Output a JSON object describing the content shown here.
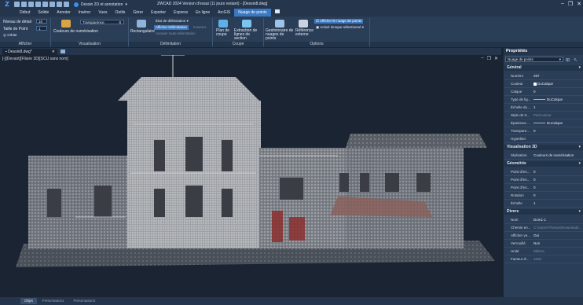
{
  "titlebar": {
    "workspace": "Dessin 2D et annotation",
    "title": "ZWCAD 2024 Version d'essai (11 jours restant) - [Dessin8.dwg]"
  },
  "tabs": [
    "Début",
    "Solide",
    "Annoter",
    "Insérer",
    "Vues",
    "Outils",
    "Gérer",
    "Exporter",
    "Express",
    "En ligne",
    "ArcGIS",
    "Nuage de points"
  ],
  "active_tab": "Nuage de points",
  "ribbon": {
    "afficher": {
      "title": "Afficher",
      "detail_label": "Niveau de détail",
      "detail_value": "10",
      "point_size_label": "Taille de Point",
      "point_size_value": "1",
      "orbit_label": "Orbite"
    },
    "visualisation": {
      "title": "Visualisation",
      "colors_label": "Couleurs de numérisation",
      "transparency_label": "Transparence",
      "transparency_value": "8"
    },
    "delimitation": {
      "title": "Délimitation",
      "rect_label": "Rectangulaire",
      "state_label": "État de délimitation",
      "show_clip_label": "Afficher Délimitation",
      "inverse_label": "Inverser",
      "remove_label": "Annuler toute délimitation"
    },
    "coupe": {
      "title": "Coupe",
      "plan_label": "Plan de coupe",
      "extract_label": "Extraction de lignes de section"
    },
    "options": {
      "title": "Options",
      "manager_label": "Gestionnaire de nuages de points",
      "external_label": "Référence externe",
      "show_cloud_label": "Afficher le nuage de points",
      "toolbar_label": "Activé lorsque sélectionné"
    }
  },
  "doc_tab": "Dessin8.dwg*",
  "viewport_label": "[-][Devant][Filaire 3D][SCU sans nom]",
  "properties": {
    "title": "Propriétés",
    "selection": "Nuage de points",
    "sections": [
      {
        "name": "Général",
        "rows": [
          {
            "k": "Numéro",
            "v": "267"
          },
          {
            "k": "Couleur",
            "v": "DuCalque",
            "swatch": "#ffffff"
          },
          {
            "k": "Calque",
            "v": "0"
          },
          {
            "k": "Type de lig...",
            "v": "DuCalque",
            "line": true
          },
          {
            "k": "Échelle du ...",
            "v": "1"
          },
          {
            "k": "Style de tr...",
            "v": "ParCouleur",
            "dim": true
          },
          {
            "k": "Épaisseur ...",
            "v": "DuCalque",
            "line": true
          },
          {
            "k": "Transpare...",
            "v": "0"
          },
          {
            "k": "Hyperlien",
            "v": ""
          }
        ]
      },
      {
        "name": "Visualisation 3D",
        "rows": [
          {
            "k": "Stylisation",
            "v": "Couleurs de numérisation"
          }
        ]
      },
      {
        "name": "Géométrie",
        "rows": [
          {
            "k": "Point d'ins...",
            "v": "0"
          },
          {
            "k": "Point d'ins...",
            "v": "0"
          },
          {
            "k": "Point d'ins...",
            "v": "0"
          },
          {
            "k": "Rotation",
            "v": "0"
          },
          {
            "k": "Échelle",
            "v": "1"
          }
        ]
      },
      {
        "name": "Divers",
        "rows": [
          {
            "k": "Nom",
            "v": "Dom1-1"
          },
          {
            "k": "Chemin en...",
            "v": "C:\\Users\\Thomas\\Download\\...",
            "dim": true
          },
          {
            "k": "Afficher ve...",
            "v": "Oui"
          },
          {
            "k": "Verrouillé",
            "v": "Non"
          },
          {
            "k": "Unité",
            "v": "Mètres",
            "dim": true
          },
          {
            "k": "Facteur d'...",
            "v": "1000",
            "dim": true
          }
        ]
      }
    ]
  },
  "status_tabs": [
    "Objet",
    "Présentation1",
    "Présentation2"
  ],
  "status_active": "Objet",
  "colors": {
    "accent": "#3a78c2",
    "ribbon": "#2b3e57",
    "background": "#1b2433"
  }
}
